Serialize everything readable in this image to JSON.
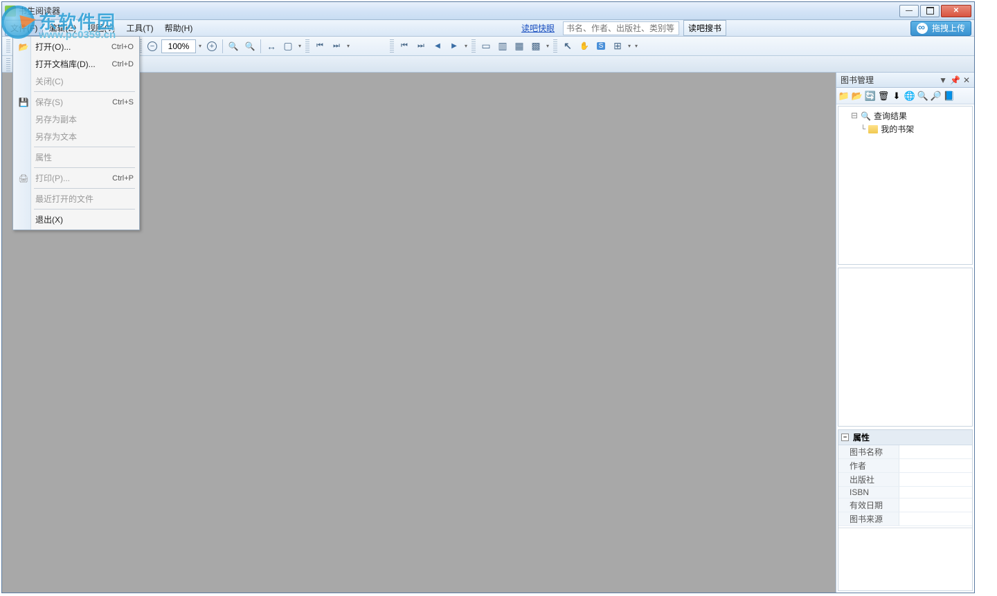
{
  "title": "书生阅读器",
  "watermark": {
    "brand": "东软件园",
    "url": "www.pc0359.cn"
  },
  "menubar": {
    "file": "文件(F)",
    "edit": "编辑(E)",
    "view": "视图(V)",
    "tool": "工具(T)",
    "help": "帮助(H)"
  },
  "header_right": {
    "link": "读吧快眼",
    "search_placeholder": "书名、作者、出版社、类别等",
    "search_btn": "读吧搜书",
    "upload": "拖拽上传"
  },
  "toolbar": {
    "zoom": "100%"
  },
  "file_menu": {
    "open": "打开(O)...",
    "open_sc": "Ctrl+O",
    "open_lib": "打开文档库(D)...",
    "open_lib_sc": "Ctrl+D",
    "close": "关闭(C)",
    "save": "保存(S)",
    "save_sc": "Ctrl+S",
    "save_copy": "另存为副本",
    "save_text": "另存为文本",
    "props": "属性",
    "print": "打印(P)...",
    "print_sc": "Ctrl+P",
    "recent": "最近打开的文件",
    "exit": "退出(X)"
  },
  "side": {
    "title": "图书管理",
    "tree": {
      "node1": "查询结果",
      "node2": "我的书架"
    },
    "props_hdr": "属性",
    "props": {
      "name": "图书名称",
      "author": "作者",
      "publisher": "出版社",
      "isbn": "ISBN",
      "valid": "有效日期",
      "source": "图书来源"
    }
  }
}
